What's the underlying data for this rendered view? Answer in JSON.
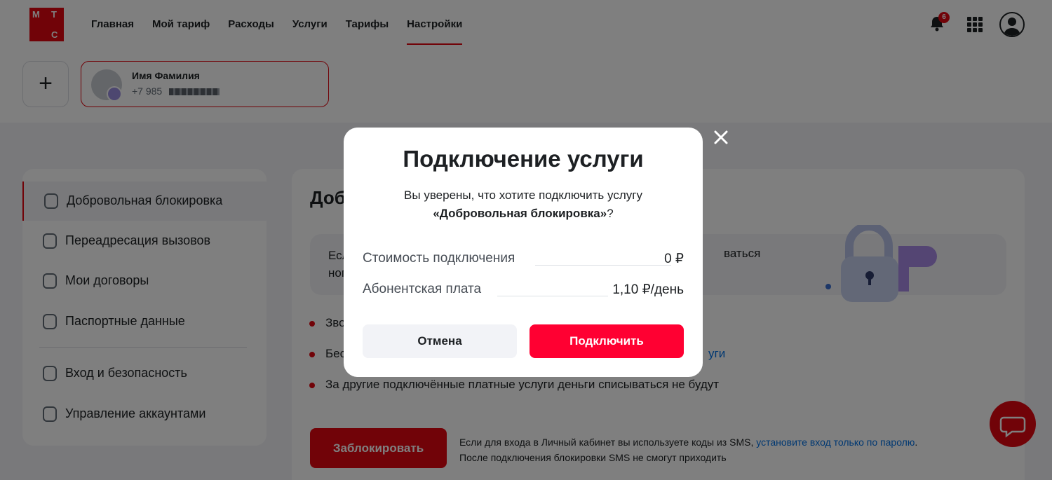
{
  "header": {
    "logo_letters": [
      "М",
      "Т",
      "С"
    ],
    "nav": [
      "Главная",
      "Мой тариф",
      "Расходы",
      "Услуги",
      "Тарифы",
      "Настройки"
    ],
    "active_nav": "Настройки",
    "notification_count": "6"
  },
  "account": {
    "add_symbol": "+",
    "name": "Имя Фамилия",
    "phone": "+7 985"
  },
  "sidebar": {
    "items": [
      {
        "label": "Добровольная блокировка",
        "icon": "lock-icon"
      },
      {
        "label": "Переадресация вызовов",
        "icon": "call-forward-icon"
      },
      {
        "label": "Мои договоры",
        "icon": "document-icon"
      },
      {
        "label": "Паспортные данные",
        "icon": "signature-icon"
      },
      {
        "label": "Вход и безопасность",
        "icon": "login-icon"
      },
      {
        "label": "Управление аккаунтами",
        "icon": "account-icon"
      }
    ]
  },
  "main": {
    "title": "Доб",
    "info_lines": [
      "Есл",
      "ног"
    ],
    "info_tail": "ваться",
    "bullets": [
      {
        "text": "Зво"
      },
      {
        "text": "Бес",
        "link": "уги"
      },
      {
        "text": "За другие подключённые платные услуги деньги списываться не будут"
      }
    ],
    "block_button": "Заблокировать",
    "note_text": "Если для входа в Личный кабинет вы используете коды из SMS, ",
    "note_link": "установите вход только по паролю",
    "note_end": ".",
    "note_line2": "После подключения блокировки SMS не смогут приходить"
  },
  "modal": {
    "title": "Подключение услуги",
    "question": "Вы уверены, что хотите подключить услугу",
    "service": "«Добровольная блокировка»",
    "question_end": "?",
    "rows": [
      {
        "label": "Стоимость подключения",
        "value": "0 ₽"
      },
      {
        "label": "Абонентская плата",
        "value": "1,10 ₽/день"
      }
    ],
    "cancel": "Отмена",
    "confirm": "Подключить"
  }
}
